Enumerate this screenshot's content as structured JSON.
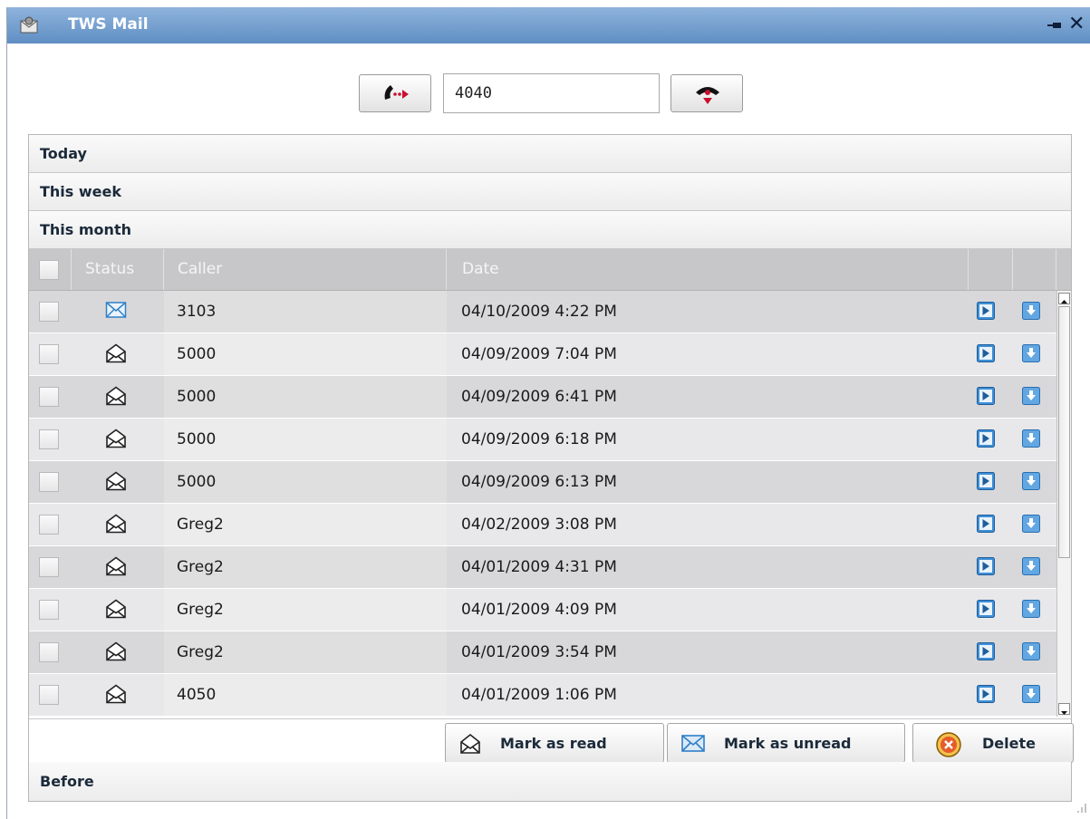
{
  "window": {
    "title": "TWS Mail"
  },
  "callbar": {
    "number_value": "4040"
  },
  "groups": {
    "today": "Today",
    "this_week": "This week",
    "this_month": "This month",
    "before": "Before"
  },
  "columns": {
    "status": "Status",
    "caller": "Caller",
    "date": "Date"
  },
  "messages": [
    {
      "status": "unread",
      "caller": "3103",
      "date": "04/10/2009 4:22 PM"
    },
    {
      "status": "read",
      "caller": "5000",
      "date": "04/09/2009 7:04 PM"
    },
    {
      "status": "read",
      "caller": "5000",
      "date": "04/09/2009 6:41 PM"
    },
    {
      "status": "read",
      "caller": "5000",
      "date": "04/09/2009 6:18 PM"
    },
    {
      "status": "read",
      "caller": "5000",
      "date": "04/09/2009 6:13 PM"
    },
    {
      "status": "read",
      "caller": "Greg2",
      "date": "04/02/2009 3:08 PM"
    },
    {
      "status": "read",
      "caller": "Greg2",
      "date": "04/01/2009 4:31 PM"
    },
    {
      "status": "read",
      "caller": "Greg2",
      "date": "04/01/2009 4:09 PM"
    },
    {
      "status": "read",
      "caller": "Greg2",
      "date": "04/01/2009 3:54 PM"
    },
    {
      "status": "read",
      "caller": "4050",
      "date": "04/01/2009 1:06 PM"
    }
  ],
  "actions": {
    "mark_read": "Mark as read",
    "mark_unread": "Mark as unread",
    "delete": "Delete"
  },
  "icons": {
    "app": "mail-app-icon",
    "pin": "pin-icon",
    "close": "close-icon",
    "call": "phone-call-icon",
    "hangup": "phone-hangup-icon",
    "unread": "envelope-closed-icon",
    "read": "envelope-open-icon",
    "play": "play-icon",
    "download": "download-icon",
    "delete": "delete-icon"
  },
  "colors": {
    "titlebar": "#5f8ec4",
    "accent_blue": "#2f7fc8",
    "call_red": "#c8102e"
  }
}
